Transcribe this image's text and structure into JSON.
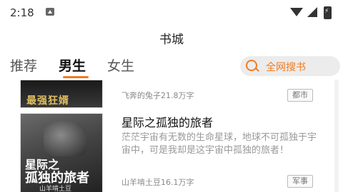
{
  "status_bar": {
    "time": "2:18"
  },
  "header": {
    "title": "书城"
  },
  "tabs": [
    {
      "label": "推荐"
    },
    {
      "label": "男生"
    },
    {
      "label": "女生"
    }
  ],
  "active_tab": "男生",
  "search": {
    "label": "全网搜书"
  },
  "books": [
    {
      "cover_text": "最强狂婿",
      "author_words": "飞奔的兔子21.8万字",
      "tag": "都市"
    },
    {
      "title": "星际之孤独的旅者",
      "description": "茫茫宇宙有无数的生命星球，地球不可孤独于宇宙中，可是我却是这宇宙中孤独的旅者！",
      "cover_line1": "星际之",
      "cover_line2": "孤独的旅者",
      "cover_author": "山羊啃土豆",
      "author_words": "山羊啃土豆16.1万字",
      "tag": "军事"
    }
  ],
  "colors": {
    "accent": "#f07b22"
  }
}
